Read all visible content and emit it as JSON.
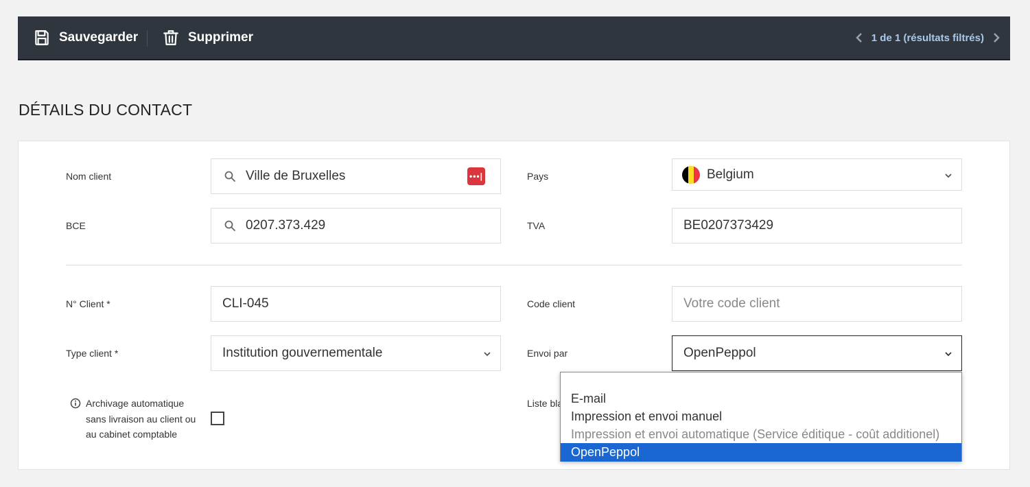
{
  "toolbar": {
    "save_label": "Sauvegarder",
    "delete_label": "Supprimer",
    "pager_text": "1 de 1 (résultats filtrés)"
  },
  "section": {
    "title": "DÉTAILS DU CONTACT"
  },
  "form": {
    "nom_client": {
      "label": "Nom client",
      "value": "Ville de Bruxelles",
      "badge": "•••|"
    },
    "pays": {
      "label": "Pays",
      "value": "Belgium"
    },
    "bce": {
      "label": "BCE",
      "value": "0207.373.429"
    },
    "tva": {
      "label": "TVA",
      "value": "BE0207373429"
    },
    "numero_client": {
      "label": "N° Client *",
      "value": "CLI-045"
    },
    "code_client": {
      "label": "Code client",
      "placeholder": "Votre code client"
    },
    "type_client": {
      "label": "Type client *",
      "value": "Institution gouvernementale"
    },
    "envoi_par": {
      "label": "Envoi par",
      "value": "OpenPeppol"
    },
    "archivage": {
      "label": "Archivage automatique sans livraison au client ou au cabinet comptable",
      "checked": false
    },
    "liste_partial": {
      "label": "Liste bla d'existe"
    }
  },
  "dropdown": {
    "options": [
      {
        "label": "",
        "state": "empty"
      },
      {
        "label": "E-mail",
        "state": "normal"
      },
      {
        "label": "Impression et envoi manuel",
        "state": "normal"
      },
      {
        "label": "Impression et envoi automatique (Service éditique - coût additionel)",
        "state": "disabled"
      },
      {
        "label": "OpenPeppol",
        "state": "selected"
      }
    ]
  },
  "colors": {
    "toolbar_bg": "#30363d",
    "pager_text": "#a9c9ec",
    "selected_option": "#1a66d2",
    "badge": "#d9363e",
    "flag": [
      "#000000",
      "#fdda24",
      "#ef3340"
    ]
  }
}
